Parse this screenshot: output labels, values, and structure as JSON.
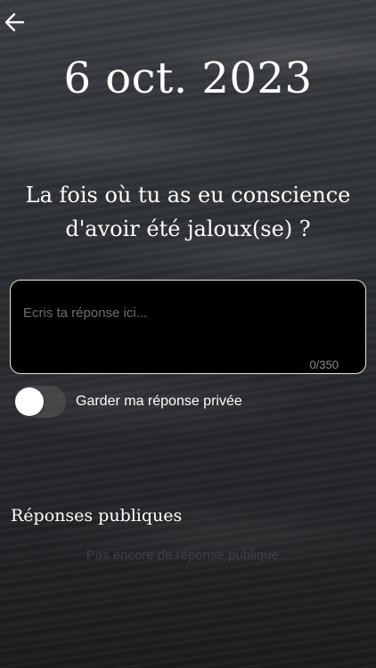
{
  "date": "6 oct. 2023",
  "question": "La fois où tu as eu conscience d'avoir été jaloux(se) ?",
  "answer": {
    "value": "",
    "placeholder": "Ecris ta réponse ici...",
    "counter": "0/350"
  },
  "privacy_toggle": {
    "label": "Garder ma réponse privée",
    "on": false
  },
  "public_answers": {
    "title": "Réponses publiques",
    "empty_text": "Pas encore de réponse publique..."
  },
  "icons": {
    "back": "arrow-left-icon"
  },
  "colors": {
    "text": "#ffffff",
    "box_bg": "#000000",
    "box_border": "#e6e6e6"
  }
}
